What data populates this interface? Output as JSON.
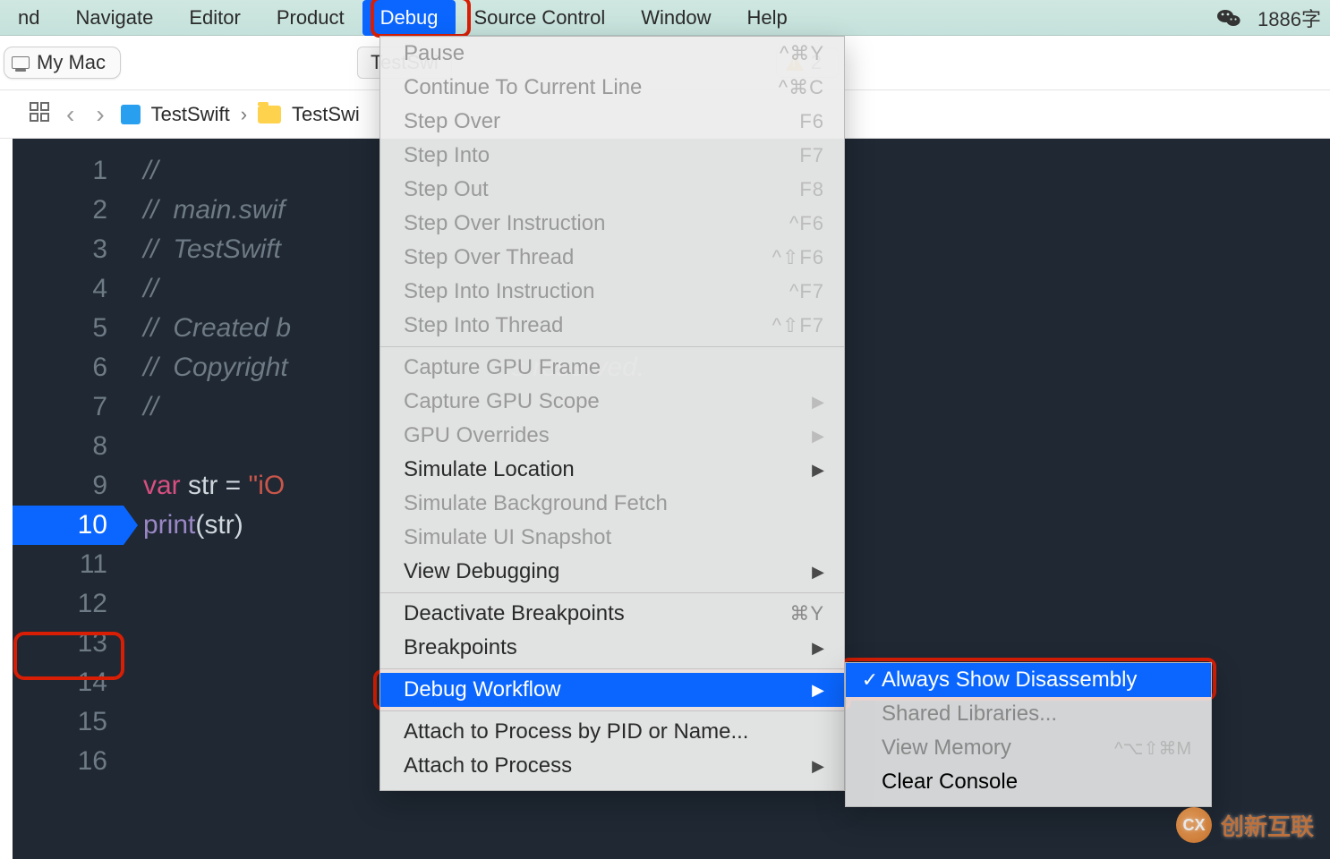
{
  "menubar": {
    "items": [
      {
        "label": "nd"
      },
      {
        "label": "Navigate"
      },
      {
        "label": "Editor"
      },
      {
        "label": "Product"
      },
      {
        "label": "Debug",
        "selected": true
      },
      {
        "label": "Source Control"
      },
      {
        "label": "Window"
      },
      {
        "label": "Help"
      }
    ],
    "status_text": "1886字"
  },
  "toolbar": {
    "device": "My Mac",
    "scheme": "TestSwi",
    "issues_count": "2"
  },
  "breadcrumb": {
    "grid_icon": "grid-icon",
    "items": [
      "TestSwift",
      "TestSwi"
    ]
  },
  "editor": {
    "breakpoint_line": 10,
    "lines": [
      {
        "n": 1,
        "text": "//",
        "type": "cmt"
      },
      {
        "n": 2,
        "text": "//  main.swif",
        "type": "cmt"
      },
      {
        "n": 3,
        "text": "//  TestSwift",
        "type": "cmt"
      },
      {
        "n": 4,
        "text": "//",
        "type": "cmt"
      },
      {
        "n": 5,
        "text": "//  Created b",
        "type": "cmt"
      },
      {
        "n": 6,
        "text": "//  Copyright                              s reserved.",
        "type": "cmt"
      },
      {
        "n": 7,
        "text": "//",
        "type": "cmt"
      },
      {
        "n": 8,
        "text": "",
        "type": "blank"
      },
      {
        "n": 9,
        "kw": "var",
        "ident": " str = ",
        "str": "\"iO"
      },
      {
        "n": 10,
        "fn": "print",
        "paren1": "(",
        "arg": "str",
        "paren2": ")"
      },
      {
        "n": 11,
        "text": "",
        "type": "blank"
      },
      {
        "n": 12,
        "text": "",
        "type": "blank"
      },
      {
        "n": 13,
        "text": "",
        "type": "blank"
      },
      {
        "n": 14,
        "text": "",
        "type": "blank"
      },
      {
        "n": 15,
        "text": "",
        "type": "blank"
      },
      {
        "n": 16,
        "text": "",
        "type": "blank"
      }
    ]
  },
  "debug_menu": {
    "groups": [
      [
        {
          "label": "Pause",
          "short": "^⌘Y",
          "disabled": true
        },
        {
          "label": "Continue To Current Line",
          "short": "^⌘C",
          "disabled": true
        },
        {
          "label": "Step Over",
          "short": "F6",
          "disabled": true
        },
        {
          "label": "Step Into",
          "short": "F7",
          "disabled": true
        },
        {
          "label": "Step Out",
          "short": "F8",
          "disabled": true
        },
        {
          "label": "Step Over Instruction",
          "short": "^F6",
          "disabled": true
        },
        {
          "label": "Step Over Thread",
          "short": "^⇧F6",
          "disabled": true
        },
        {
          "label": "Step Into Instruction",
          "short": "^F7",
          "disabled": true
        },
        {
          "label": "Step Into Thread",
          "short": "^⇧F7",
          "disabled": true
        }
      ],
      [
        {
          "label": "Capture GPU Frame",
          "disabled": true
        },
        {
          "label": "Capture GPU Scope",
          "disabled": true,
          "arrow": true
        },
        {
          "label": "GPU Overrides",
          "disabled": true,
          "arrow": true
        },
        {
          "label": "Simulate Location",
          "arrow": true
        },
        {
          "label": "Simulate Background Fetch",
          "disabled": true
        },
        {
          "label": "Simulate UI Snapshot",
          "disabled": true
        },
        {
          "label": "View Debugging",
          "arrow": true
        }
      ],
      [
        {
          "label": "Deactivate Breakpoints",
          "short": "⌘Y"
        },
        {
          "label": "Breakpoints",
          "arrow": true
        }
      ],
      [
        {
          "label": "Debug Workflow",
          "arrow": true,
          "highlight": true,
          "outline": true
        }
      ],
      [
        {
          "label": "Attach to Process by PID or Name..."
        },
        {
          "label": "Attach to Process",
          "arrow": true
        }
      ]
    ]
  },
  "submenu": {
    "items": [
      {
        "label": "Always Show Disassembly",
        "checked": true,
        "highlight": true,
        "outline": true
      },
      {
        "label": "Shared Libraries...",
        "gray": true
      },
      {
        "label": "View Memory",
        "short": "^⌥⇧⌘M",
        "gray": true
      },
      {
        "label": "Clear Console",
        "gray": false
      }
    ]
  },
  "watermark": {
    "text": "创新互联",
    "badge": "CX"
  }
}
